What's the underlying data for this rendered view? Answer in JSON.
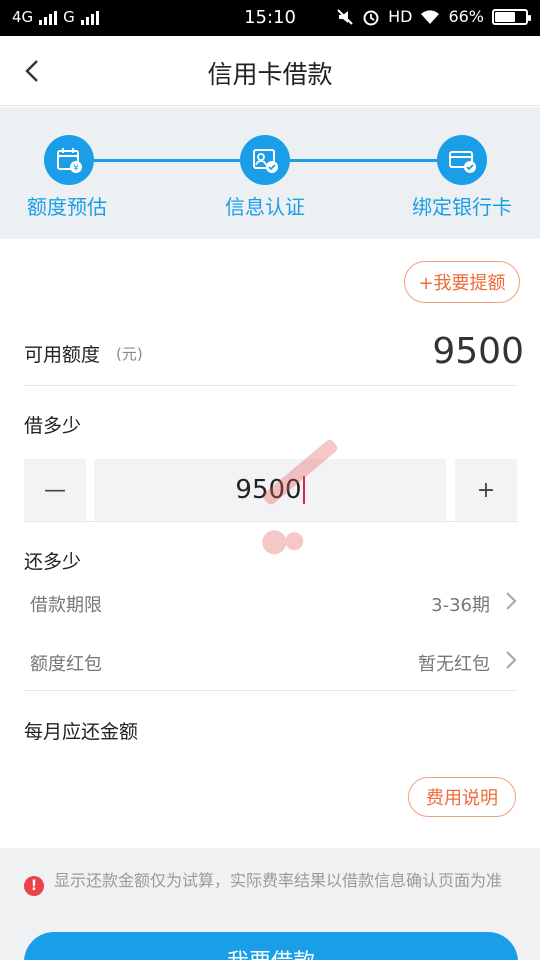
{
  "status_bar": {
    "network_1": "4G",
    "network_2": "G",
    "time": "15:10",
    "hd": "HD",
    "battery_percent": "66%",
    "battery_level": 0.66
  },
  "header": {
    "title": "信用卡借款",
    "back_icon": "chevron-left-icon"
  },
  "steps": [
    {
      "label": "额度预估",
      "icon": "calendar-yen-icon"
    },
    {
      "label": "信息认证",
      "icon": "id-card-check-icon"
    },
    {
      "label": "绑定银行卡",
      "icon": "bank-card-check-icon"
    }
  ],
  "quota": {
    "increase_label": "+我要提额",
    "available_label": "可用额度",
    "available_unit": "(元)",
    "available_value": "9500"
  },
  "borrow": {
    "label": "借多少",
    "minus": "—",
    "amount": "9500",
    "plus": "+"
  },
  "repay": {
    "label": "还多少",
    "rows": [
      {
        "label": "借款期限",
        "value": "3-36期"
      },
      {
        "label": "额度红包",
        "value": "暂无红包"
      }
    ]
  },
  "monthly": {
    "label": "每月应还金额",
    "fee_label": "费用说明"
  },
  "notice": {
    "icon_symbol": "!",
    "text": "显示还款金额仅为试算，实际费率结果以借款信息确认页面为准"
  },
  "submit": {
    "label": "我要借款"
  },
  "colors": {
    "accent": "#1a9ee8",
    "orange": "#ee6b3b",
    "alert": "#e8434a"
  }
}
